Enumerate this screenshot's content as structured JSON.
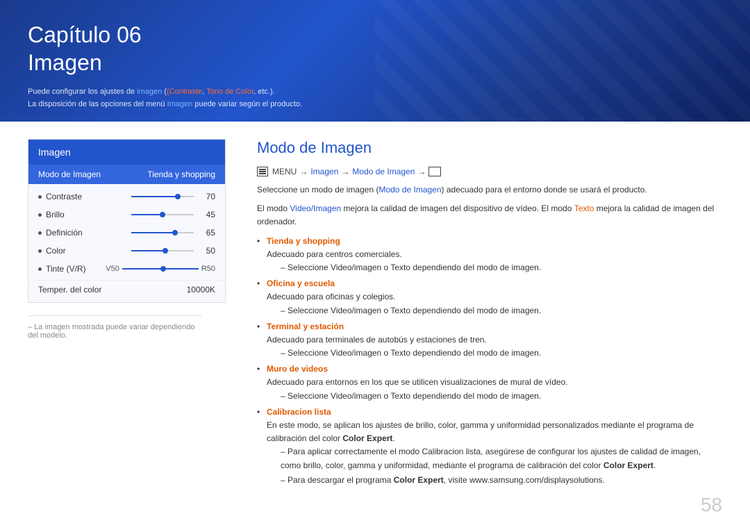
{
  "header": {
    "chapter": "Capítulo 06",
    "title": "Imagen",
    "desc_line1_pre": "Puede configurar los ajustes de ",
    "desc_line1_img": "imagen",
    "desc_line1_orange1": "(Contraste",
    "desc_line1_sep": ", ",
    "desc_line1_orange2": "Tono de Color",
    "desc_line1_post": ", etc.).",
    "desc_line2_pre": "La disposición de las opciones del menú ",
    "desc_line2_img": "Imagen",
    "desc_line2_post": " puede variar según el producto."
  },
  "left_panel": {
    "menu_title": "Imagen",
    "col_left": "Modo de Imagen",
    "col_right": "Tienda y shopping",
    "items": [
      {
        "label": "Contraste",
        "value": "70",
        "fill_pct": 70
      },
      {
        "label": "Brillo",
        "value": "45",
        "fill_pct": 45
      },
      {
        "label": "Definición",
        "value": "65",
        "fill_pct": 65
      },
      {
        "label": "Color",
        "value": "50",
        "fill_pct": 50
      }
    ],
    "tint_label": "Tinte (V/R)",
    "tint_left": "V50",
    "tint_right": "R50",
    "temper_label": "Temper. del color",
    "temper_value": "10000K",
    "note": "– La imagen mostrada puede variar dependiendo del modelo."
  },
  "right_panel": {
    "section_title": "Modo de Imagen",
    "menu_path": {
      "icon_label": "MENU",
      "arrow1": "→",
      "item1": "Imagen",
      "arrow2": "→",
      "item2": "Modo de Imagen",
      "arrow3": "→"
    },
    "desc1_pre": "Seleccione un modo de imagen (",
    "desc1_highlight": "Modo de Imagen",
    "desc1_post": ") adecuado para el entorno donde se usará el producto.",
    "desc2_pre": "El modo ",
    "desc2_blue1": "Video/Imagen",
    "desc2_mid1": " mejora la calidad de imagen del dispositivo de vídeo. El modo ",
    "desc2_orange1": "Texto",
    "desc2_post1": " mejora la calidad de imagen del ordenador.",
    "bullets": [
      {
        "title": "Tienda y shopping",
        "title_color": "orange",
        "desc": "Adecuado para centros comerciales.",
        "sub": "Seleccione Video/imagen o Texto dependiendo del modo de imagen."
      },
      {
        "title": "Oficina y escuela",
        "title_color": "orange",
        "desc": "Adecuado para oficinas y colegios.",
        "sub": "Seleccione Video/imagen o Texto dependiendo del modo de imagen."
      },
      {
        "title": "Terminal y estación",
        "title_color": "orange",
        "desc": "Adecuado para terminales de autobús y estaciones de tren.",
        "sub": "Seleccione Video/imagen o Texto dependiendo del modo de imagen."
      },
      {
        "title": "Muro de videos",
        "title_color": "orange",
        "desc": "Adecuado para entornos en los que se utilicen visualizaciones de mural de vídeo.",
        "sub": "Seleccione Video/imagen o Texto dependiendo del modo de imagen."
      },
      {
        "title": "Calibracion lista",
        "title_color": "orange",
        "desc": "En este modo, se aplican los ajustes de brillo, color, gamma y uniformidad personalizados mediante el programa de calibración del color Color Expert.",
        "subs": [
          "Para aplicar correctamente el modo Calibracion lista, asegúrese de configurar los ajustes de calidad de imagen, como brillo, color, gamma y uniformidad, mediante el programa de calibración del color Color Expert.",
          "Para descargar el programa Color Expert, visite www.samsung.com/displaysolutions."
        ]
      }
    ]
  },
  "page_number": "58"
}
